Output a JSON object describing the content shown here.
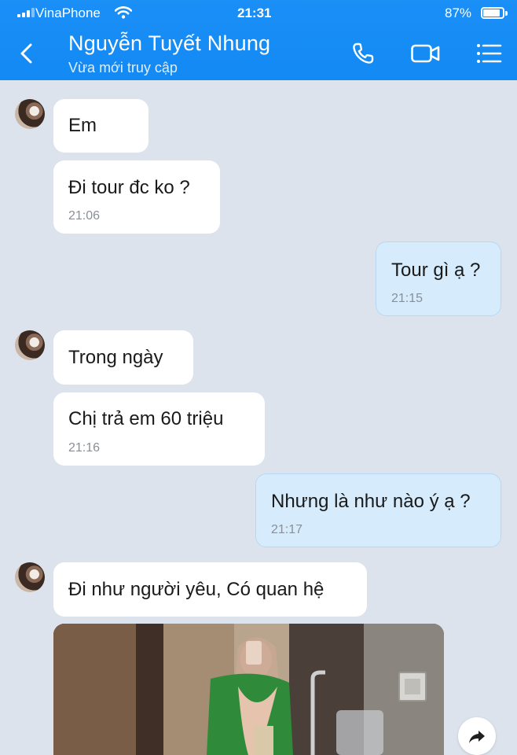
{
  "status_bar": {
    "carrier": "VinaPhone",
    "time": "21:31",
    "battery": "87%",
    "battery_level": 0.87
  },
  "header": {
    "contact_name": "Nguyễn Tuyết Nhung",
    "presence": "Vừa mới truy cập",
    "icons": [
      "chevron-left-icon",
      "phone-icon",
      "video-camera-icon",
      "menu-list-icon"
    ],
    "accent_color": "#1a8ff6"
  },
  "messages": [
    {
      "side": "in",
      "text": "Em",
      "time": ""
    },
    {
      "side": "in",
      "text": "Đi tour đc ko ?",
      "time": "21:06"
    },
    {
      "side": "out",
      "text": "Tour gì ạ ?",
      "time": "21:15"
    },
    {
      "side": "in",
      "text": "Trong ngày",
      "time": ""
    },
    {
      "side": "in",
      "text": "Chị trả em 60 triệu",
      "time": "21:16"
    },
    {
      "side": "out",
      "text": "Nhưng là như nào ý ạ ?",
      "time": "21:17"
    },
    {
      "side": "in",
      "text": "Đi như người yêu, Có quan hệ",
      "time": ""
    }
  ],
  "colors": {
    "incoming_bubble": "#ffffff",
    "outgoing_bubble": "#d6ecfd",
    "chat_background": "#dde3ec"
  }
}
